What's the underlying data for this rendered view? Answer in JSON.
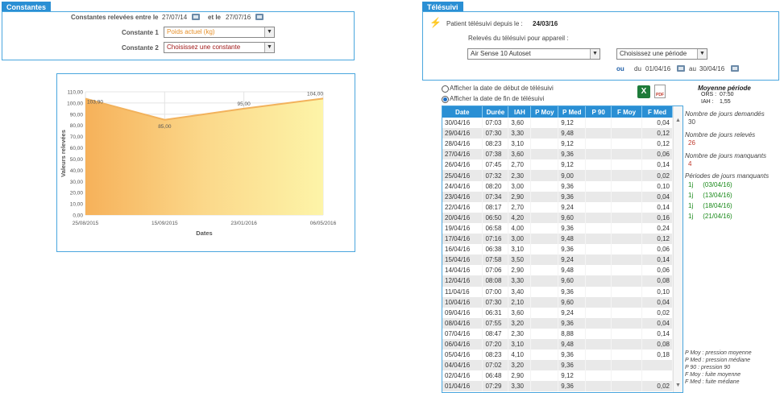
{
  "constantes": {
    "tab": "Constantes",
    "releve_label": "Constantes relevées entre le",
    "date_from": "27/07/14",
    "et_le": "et le",
    "date_to": "27/07/16",
    "c1_label": "Constante 1",
    "c1_value": "Poids actuel (kg)",
    "c2_label": "Constante 2",
    "c2_value": "Choisissez une constante"
  },
  "chart_data": {
    "type": "area",
    "x": [
      "25/08/2015",
      "15/09/2015",
      "23/01/2016",
      "06/05/2016"
    ],
    "values": [
      103.9,
      85.0,
      95.0,
      104.0
    ],
    "value_labels": [
      "103,90",
      "85,00",
      "95,00",
      "104,00"
    ],
    "yticks": [
      "110,00",
      "100,00",
      "90,00",
      "80,00",
      "70,00",
      "60,00",
      "50,00",
      "40,00",
      "30,00",
      "20,00",
      "10,00",
      "0,00"
    ],
    "ylim": [
      0,
      110
    ],
    "xlabel": "Dates",
    "ylabel": "Valeurs relevées",
    "grid": true
  },
  "telesuivi": {
    "tab": "Télésuivi",
    "patient_label": "Patient télésuivi depuis le :",
    "patient_since": "24/03/16",
    "releves_label": "Relevés du télésuivi pour appareil :",
    "device": "Air Sense 10 Autoset",
    "periode": "Choisissez une période",
    "ou": "ou",
    "du": "du",
    "date_from": "01/04/16",
    "au": "au",
    "date_to": "30/04/16"
  },
  "options": {
    "radio1": "Afficher la date de début de télésuivi",
    "radio2": "Afficher la date de fin de télésuivi",
    "excel_icon": "excel-icon",
    "pdf_icon": "pdf-icon"
  },
  "summary": {
    "title": "Moyenne période",
    "ors_label": "ORS :",
    "ors_value": "07:50",
    "iah_label": "IAH :",
    "iah_value": "1,55",
    "demandes_label": "Nombre de jours demandés",
    "demandes_value": "30",
    "releves_label": "Nombre de jours relevés",
    "releves_value": "26",
    "manquants_label": "Nombre de jours manquants",
    "manquants_value": "4",
    "periodes_label": "Périodes de jours manquants",
    "periodes": [
      {
        "duree": "1j",
        "date": "(03/04/16)"
      },
      {
        "duree": "1j",
        "date": "(13/04/16)"
      },
      {
        "duree": "1j",
        "date": "(18/04/16)"
      },
      {
        "duree": "1j",
        "date": "(21/04/16)"
      }
    ],
    "legend": [
      "P Moy : pression moyenne",
      "P Med : pression médiane",
      "P 90 : pression 90",
      "F Moy : fuite moyenne",
      "F Med : fuite médiane"
    ]
  },
  "table": {
    "headers": [
      "Date",
      "Durée",
      "IAH",
      "P Moy",
      "P Med",
      "P 90",
      "F Moy",
      "F Med"
    ],
    "rows": [
      [
        "30/04/16",
        "07:03",
        "3,60",
        "",
        "9,12",
        "",
        "",
        "0,04"
      ],
      [
        "29/04/16",
        "07:30",
        "3,30",
        "",
        "9,48",
        "",
        "",
        "0,12"
      ],
      [
        "28/04/16",
        "08:23",
        "3,10",
        "",
        "9,12",
        "",
        "",
        "0,12"
      ],
      [
        "27/04/16",
        "07:38",
        "3,60",
        "",
        "9,36",
        "",
        "",
        "0,06"
      ],
      [
        "26/04/16",
        "07:45",
        "2,70",
        "",
        "9,12",
        "",
        "",
        "0,14"
      ],
      [
        "25/04/16",
        "07:32",
        "2,30",
        "",
        "9,00",
        "",
        "",
        "0,02"
      ],
      [
        "24/04/16",
        "08:20",
        "3,00",
        "",
        "9,36",
        "",
        "",
        "0,10"
      ],
      [
        "23/04/16",
        "07:34",
        "2,90",
        "",
        "9,36",
        "",
        "",
        "0,04"
      ],
      [
        "22/04/16",
        "08:17",
        "2,70",
        "",
        "9,24",
        "",
        "",
        "0,14"
      ],
      [
        "20/04/16",
        "06:50",
        "4,20",
        "",
        "9,60",
        "",
        "",
        "0,16"
      ],
      [
        "19/04/16",
        "06:58",
        "4,00",
        "",
        "9,36",
        "",
        "",
        "0,24"
      ],
      [
        "17/04/16",
        "07:16",
        "3,00",
        "",
        "9,48",
        "",
        "",
        "0,12"
      ],
      [
        "16/04/16",
        "06:38",
        "3,10",
        "",
        "9,36",
        "",
        "",
        "0,06"
      ],
      [
        "15/04/16",
        "07:58",
        "3,50",
        "",
        "9,24",
        "",
        "",
        "0,14"
      ],
      [
        "14/04/16",
        "07:06",
        "2,90",
        "",
        "9,48",
        "",
        "",
        "0,06"
      ],
      [
        "12/04/16",
        "08:08",
        "3,30",
        "",
        "9,60",
        "",
        "",
        "0,08"
      ],
      [
        "11/04/16",
        "07:00",
        "3,40",
        "",
        "9,36",
        "",
        "",
        "0,10"
      ],
      [
        "10/04/16",
        "07:30",
        "2,10",
        "",
        "9,60",
        "",
        "",
        "0,04"
      ],
      [
        "09/04/16",
        "06:31",
        "3,60",
        "",
        "9,24",
        "",
        "",
        "0,02"
      ],
      [
        "08/04/16",
        "07:55",
        "3,20",
        "",
        "9,36",
        "",
        "",
        "0,04"
      ],
      [
        "07/04/16",
        "08:47",
        "2,30",
        "",
        "8,88",
        "",
        "",
        "0,14"
      ],
      [
        "06/04/16",
        "07:20",
        "3,10",
        "",
        "9,48",
        "",
        "",
        "0,08"
      ],
      [
        "05/04/16",
        "08:23",
        "4,10",
        "",
        "9,36",
        "",
        "",
        "0,18"
      ],
      [
        "04/04/16",
        "07:02",
        "3,20",
        "",
        "9,36",
        "",
        "",
        ""
      ],
      [
        "02/04/16",
        "06:48",
        "2,90",
        "",
        "9,12",
        "",
        "",
        ""
      ],
      [
        "01/04/16",
        "07:29",
        "3,30",
        "",
        "9,36",
        "",
        "",
        "0,02"
      ]
    ]
  }
}
